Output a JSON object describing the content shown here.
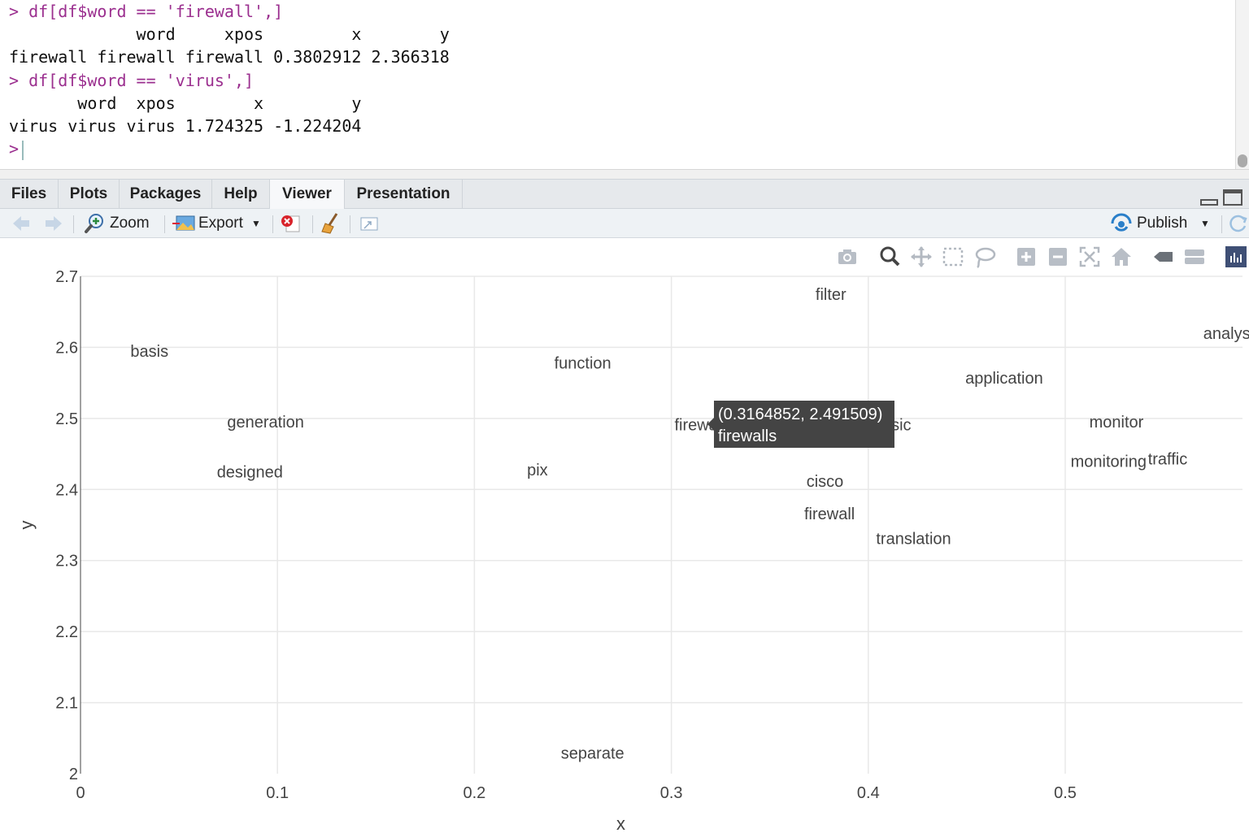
{
  "console": {
    "lines": [
      {
        "kind": "cmd",
        "text": "> df[df$word == 'firewall',]"
      },
      {
        "kind": "out",
        "text": "             word     xpos         x        y"
      },
      {
        "kind": "out",
        "text": "firewall firewall firewall 0.3802912 2.366318"
      },
      {
        "kind": "cmd",
        "text": "> df[df$word == 'virus',]"
      },
      {
        "kind": "out",
        "text": "       word  xpos        x         y"
      },
      {
        "kind": "out",
        "text": "virus virus virus 1.724325 -1.224204"
      }
    ],
    "prompt": ">"
  },
  "tabs": [
    "Files",
    "Plots",
    "Packages",
    "Help",
    "Viewer",
    "Presentation"
  ],
  "active_tab": "Viewer",
  "toolbar": {
    "back_icon": "arrow-left-icon",
    "forward_icon": "arrow-right-icon",
    "zoom_label": "Zoom",
    "export_label": "Export",
    "publish_label": "Publish"
  },
  "modebar_icons": [
    "camera-icon",
    "zoom-icon",
    "pan-icon",
    "box-select-icon",
    "lasso-select-icon",
    "zoom-in-icon",
    "zoom-out-icon",
    "autoscale-icon",
    "reset-axes-icon",
    "hover-closest-icon",
    "hover-compare-icon",
    "plotly-logo-icon"
  ],
  "chart_data": {
    "type": "scatter",
    "mode": "text",
    "xlabel": "x",
    "ylabel": "y",
    "xlim": [
      0,
      0.59
    ],
    "ylim": [
      2.0,
      2.7
    ],
    "x_ticks": [
      0,
      0.1,
      0.2,
      0.3,
      0.4,
      0.5
    ],
    "x_tick_labels": [
      "0",
      "0.1",
      "0.2",
      "0.3",
      "0.4",
      "0.5"
    ],
    "y_ticks": [
      2.0,
      2.1,
      2.2,
      2.3,
      2.4,
      2.5,
      2.6,
      2.7
    ],
    "y_tick_labels": [
      "2",
      "2.1",
      "2.2",
      "2.3",
      "2.4",
      "2.5",
      "2.6",
      "2.7"
    ],
    "grid": true,
    "points": [
      {
        "label": "basis",
        "x": 0.035,
        "y": 2.595
      },
      {
        "label": "generation",
        "x": 0.094,
        "y": 2.495
      },
      {
        "label": "designed",
        "x": 0.086,
        "y": 2.425
      },
      {
        "label": "function",
        "x": 0.255,
        "y": 2.578
      },
      {
        "label": "pix",
        "x": 0.232,
        "y": 2.428
      },
      {
        "label": "filter",
        "x": 0.381,
        "y": 2.675
      },
      {
        "label": "firewalls",
        "x": 0.3165,
        "y": 2.4915
      },
      {
        "label": "music",
        "x": 0.411,
        "y": 2.491
      },
      {
        "label": "cisco",
        "x": 0.378,
        "y": 2.412
      },
      {
        "label": "firewall",
        "x": 0.3803,
        "y": 2.366
      },
      {
        "label": "translation",
        "x": 0.423,
        "y": 2.331
      },
      {
        "label": "application",
        "x": 0.469,
        "y": 2.557
      },
      {
        "label": "monitor",
        "x": 0.526,
        "y": 2.495
      },
      {
        "label": "monitoring",
        "x": 0.522,
        "y": 2.44
      },
      {
        "label": "traffic",
        "x": 0.552,
        "y": 2.443
      },
      {
        "label": "analysis",
        "x": 0.585,
        "y": 2.62
      },
      {
        "label": "separate",
        "x": 0.26,
        "y": 2.029
      }
    ],
    "tooltip": {
      "coords": "(0.3164852, 2.491509)",
      "label": "firewalls"
    }
  }
}
